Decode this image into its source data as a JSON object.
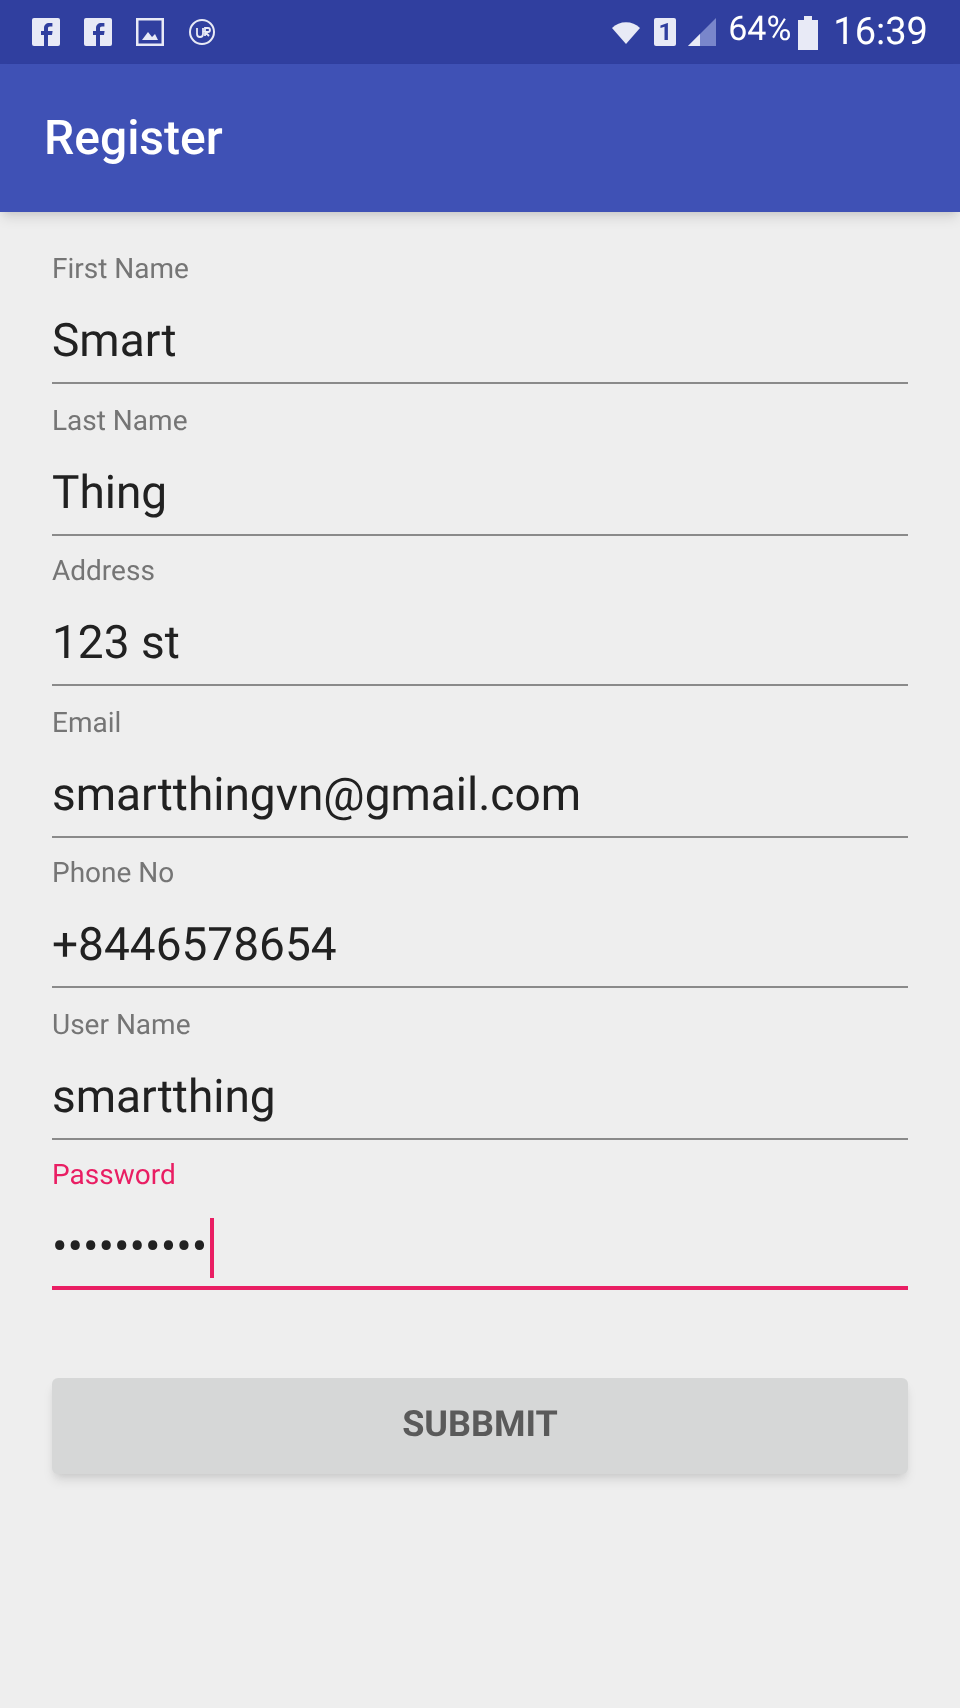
{
  "status_bar": {
    "sim": "1",
    "battery": "64%",
    "time": "16:39"
  },
  "app_bar": {
    "title": "Register"
  },
  "fields": [
    {
      "label": "First Name",
      "value": "Smart",
      "focused": false
    },
    {
      "label": "Last Name",
      "value": "Thing",
      "focused": false
    },
    {
      "label": "Address",
      "value": "123 st",
      "focused": false
    },
    {
      "label": "Email",
      "value": "smartthingvn@gmail.com",
      "focused": false
    },
    {
      "label": "Phone No",
      "value": "+8446578654",
      "focused": false
    },
    {
      "label": "User Name",
      "value": "smartthing",
      "focused": false
    },
    {
      "label": "Password",
      "value": "••••••••••",
      "focused": true
    }
  ],
  "button": {
    "label": "SUBBMIT"
  }
}
